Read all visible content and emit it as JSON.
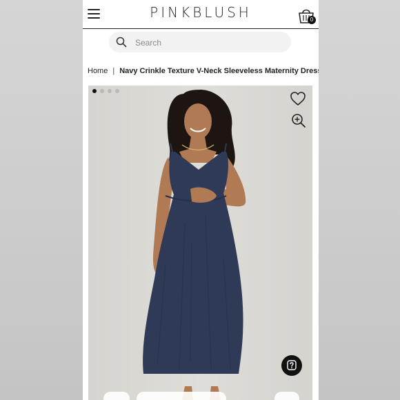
{
  "header": {
    "brand": "PINKBLUSH",
    "cart_count": "0"
  },
  "search": {
    "placeholder": "Search"
  },
  "breadcrumb": {
    "home": "Home",
    "separator": "|",
    "current": "Navy Crinkle Texture V-Neck Sleeveless Maternity Dress"
  },
  "gallery": {
    "image_count": 4,
    "active_index": 0,
    "icons": [
      "heart-icon",
      "zoom-in-icon",
      "help-icon"
    ]
  },
  "colors": {
    "dress": "#2e3a55",
    "accent": "#111111"
  }
}
